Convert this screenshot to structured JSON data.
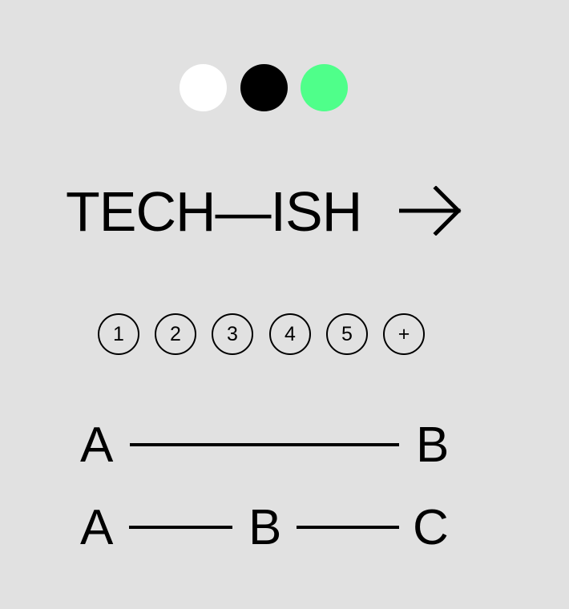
{
  "swatches": {
    "white": "#ffffff",
    "black": "#000000",
    "green": "#4fff8a"
  },
  "brand": {
    "text": "TECH—ISH",
    "arrow_icon": "arrow-right-icon"
  },
  "steps": [
    "1",
    "2",
    "3",
    "4",
    "5",
    "+"
  ],
  "route_two": {
    "start": "A",
    "end": "B"
  },
  "route_three": {
    "start": "A",
    "middle": "B",
    "end": "C"
  }
}
